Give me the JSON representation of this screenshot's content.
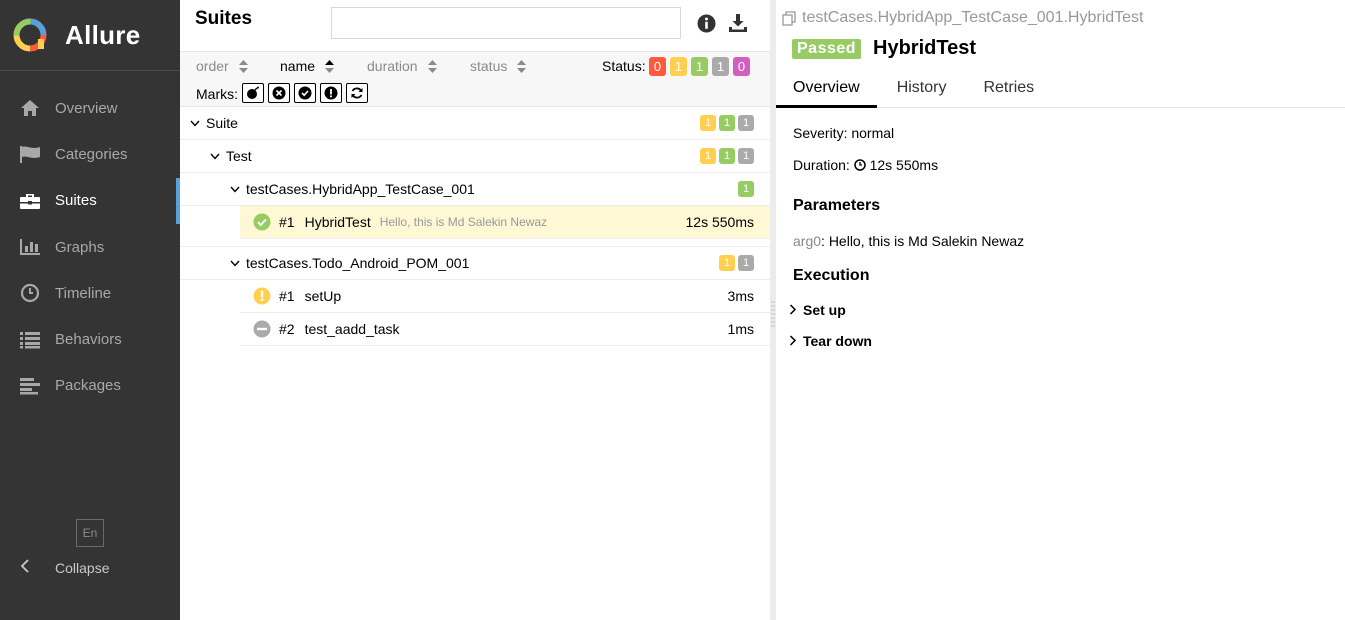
{
  "app": {
    "title": "Allure"
  },
  "sidebar": {
    "items": [
      {
        "label": "Overview",
        "icon": "home-icon"
      },
      {
        "label": "Categories",
        "icon": "flag-icon"
      },
      {
        "label": "Suites",
        "icon": "briefcase-icon"
      },
      {
        "label": "Graphs",
        "icon": "bar-chart-icon"
      },
      {
        "label": "Timeline",
        "icon": "clock-icon"
      },
      {
        "label": "Behaviors",
        "icon": "list-icon"
      },
      {
        "label": "Packages",
        "icon": "align-left-icon"
      }
    ],
    "language": "En",
    "collapse": "Collapse"
  },
  "suites": {
    "title": "Suites",
    "search": {
      "value": "",
      "placeholder": ""
    },
    "sort": {
      "order": "order",
      "name": "name",
      "duration": "duration",
      "status": "status"
    },
    "status_label": "Status:",
    "status_counts": [
      "0",
      "1",
      "1",
      "1",
      "0"
    ],
    "marks_label": "Marks:",
    "tree": {
      "suite": {
        "label": "Suite",
        "counts": [
          "1",
          "1",
          "1"
        ]
      },
      "test": {
        "label": "Test",
        "counts": [
          "1",
          "1",
          "1"
        ]
      },
      "group1": {
        "label": "testCases.HybridApp_TestCase_001",
        "counts": [
          "1"
        ],
        "cases": [
          {
            "num": "#1",
            "name": "HybridTest",
            "desc": "Hello, this is Md Salekin Newaz",
            "duration": "12s 550ms",
            "status": "passed"
          }
        ]
      },
      "group2": {
        "label": "testCases.Todo_Android_POM_001",
        "counts": [
          "1",
          "1"
        ],
        "cases": [
          {
            "num": "#1",
            "name": "setUp",
            "duration": "3ms",
            "status": "broken"
          },
          {
            "num": "#2",
            "name": "test_aadd_task",
            "duration": "1ms",
            "status": "skipped"
          }
        ]
      }
    }
  },
  "detail": {
    "breadcrumb": "testCases.HybridApp_TestCase_001.HybridTest",
    "status": "Passed",
    "title": "HybridTest",
    "tabs": [
      "Overview",
      "History",
      "Retries"
    ],
    "severity_label": "Severity:",
    "severity": "normal",
    "duration_label": "Duration:",
    "duration": "12s 550ms",
    "parameters_title": "Parameters",
    "param_name": "arg0",
    "param_value": "Hello, this is Md Salekin Newaz",
    "execution_title": "Execution",
    "setup": "Set up",
    "teardown": "Tear down"
  },
  "colors": {
    "failed": "#fd5a3e",
    "broken": "#ffd050",
    "passed": "#97cc64",
    "skipped": "#aaaaaa",
    "unknown": "#d35ebe",
    "sidebar": "#343434"
  }
}
